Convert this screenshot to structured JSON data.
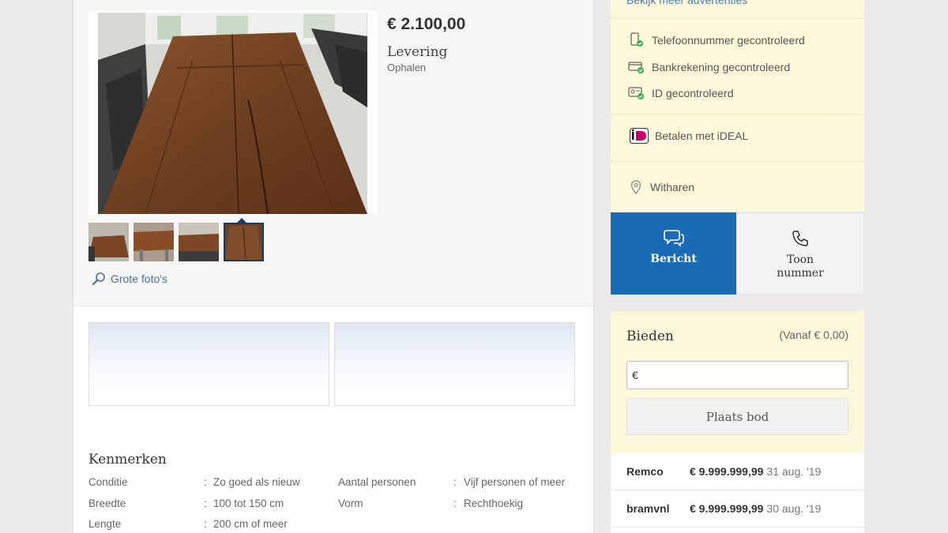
{
  "listing": {
    "price": "€ 2.100,00",
    "delivery_title": "Levering",
    "delivery_value": "Ophalen",
    "large_photos_link": "Grote foto's"
  },
  "features": {
    "title": "Kenmerken",
    "rows": [
      {
        "label": "Conditie",
        "value": "Zo goed als nieuw"
      },
      {
        "label": "Breedte",
        "value": "100 tot 150 cm"
      },
      {
        "label": "Lengte",
        "value": "200 cm of meer"
      },
      {
        "label": "Aantal personen",
        "value": "Vijf personen of meer"
      },
      {
        "label": "Vorm",
        "value": "Rechthoekig"
      }
    ]
  },
  "seller": {
    "more_ads_link": "Bekijk meer advertenties",
    "checks": [
      {
        "label": "Telefoonnummer gecontroleerd",
        "icon": "phone-verified-icon"
      },
      {
        "label": "Bankrekening gecontroleerd",
        "icon": "bank-verified-icon"
      },
      {
        "label": "ID gecontroleerd",
        "icon": "id-verified-icon"
      }
    ],
    "ideal_label": "Betalen met iDEAL",
    "location": "Witharen"
  },
  "actions": {
    "message_label": "Bericht",
    "show_number_label_1": "Toon",
    "show_number_label_2": "nummer"
  },
  "bidding": {
    "title": "Bieden",
    "from_label": "(Vanaf € 0,00)",
    "input_prefix": "€",
    "place_bid_label": "Plaats bod",
    "bids": [
      {
        "name": "Remco",
        "amount": "€ 9.999.999,99",
        "date": "31 aug. '19"
      },
      {
        "name": "bramvnl",
        "amount": "€ 9.999.999,99",
        "date": "30 aug. '19"
      }
    ]
  },
  "colors": {
    "accent_blue": "#1a6bb5",
    "seller_panel": "#fdf8d9",
    "link_blue": "#4a7db8"
  }
}
